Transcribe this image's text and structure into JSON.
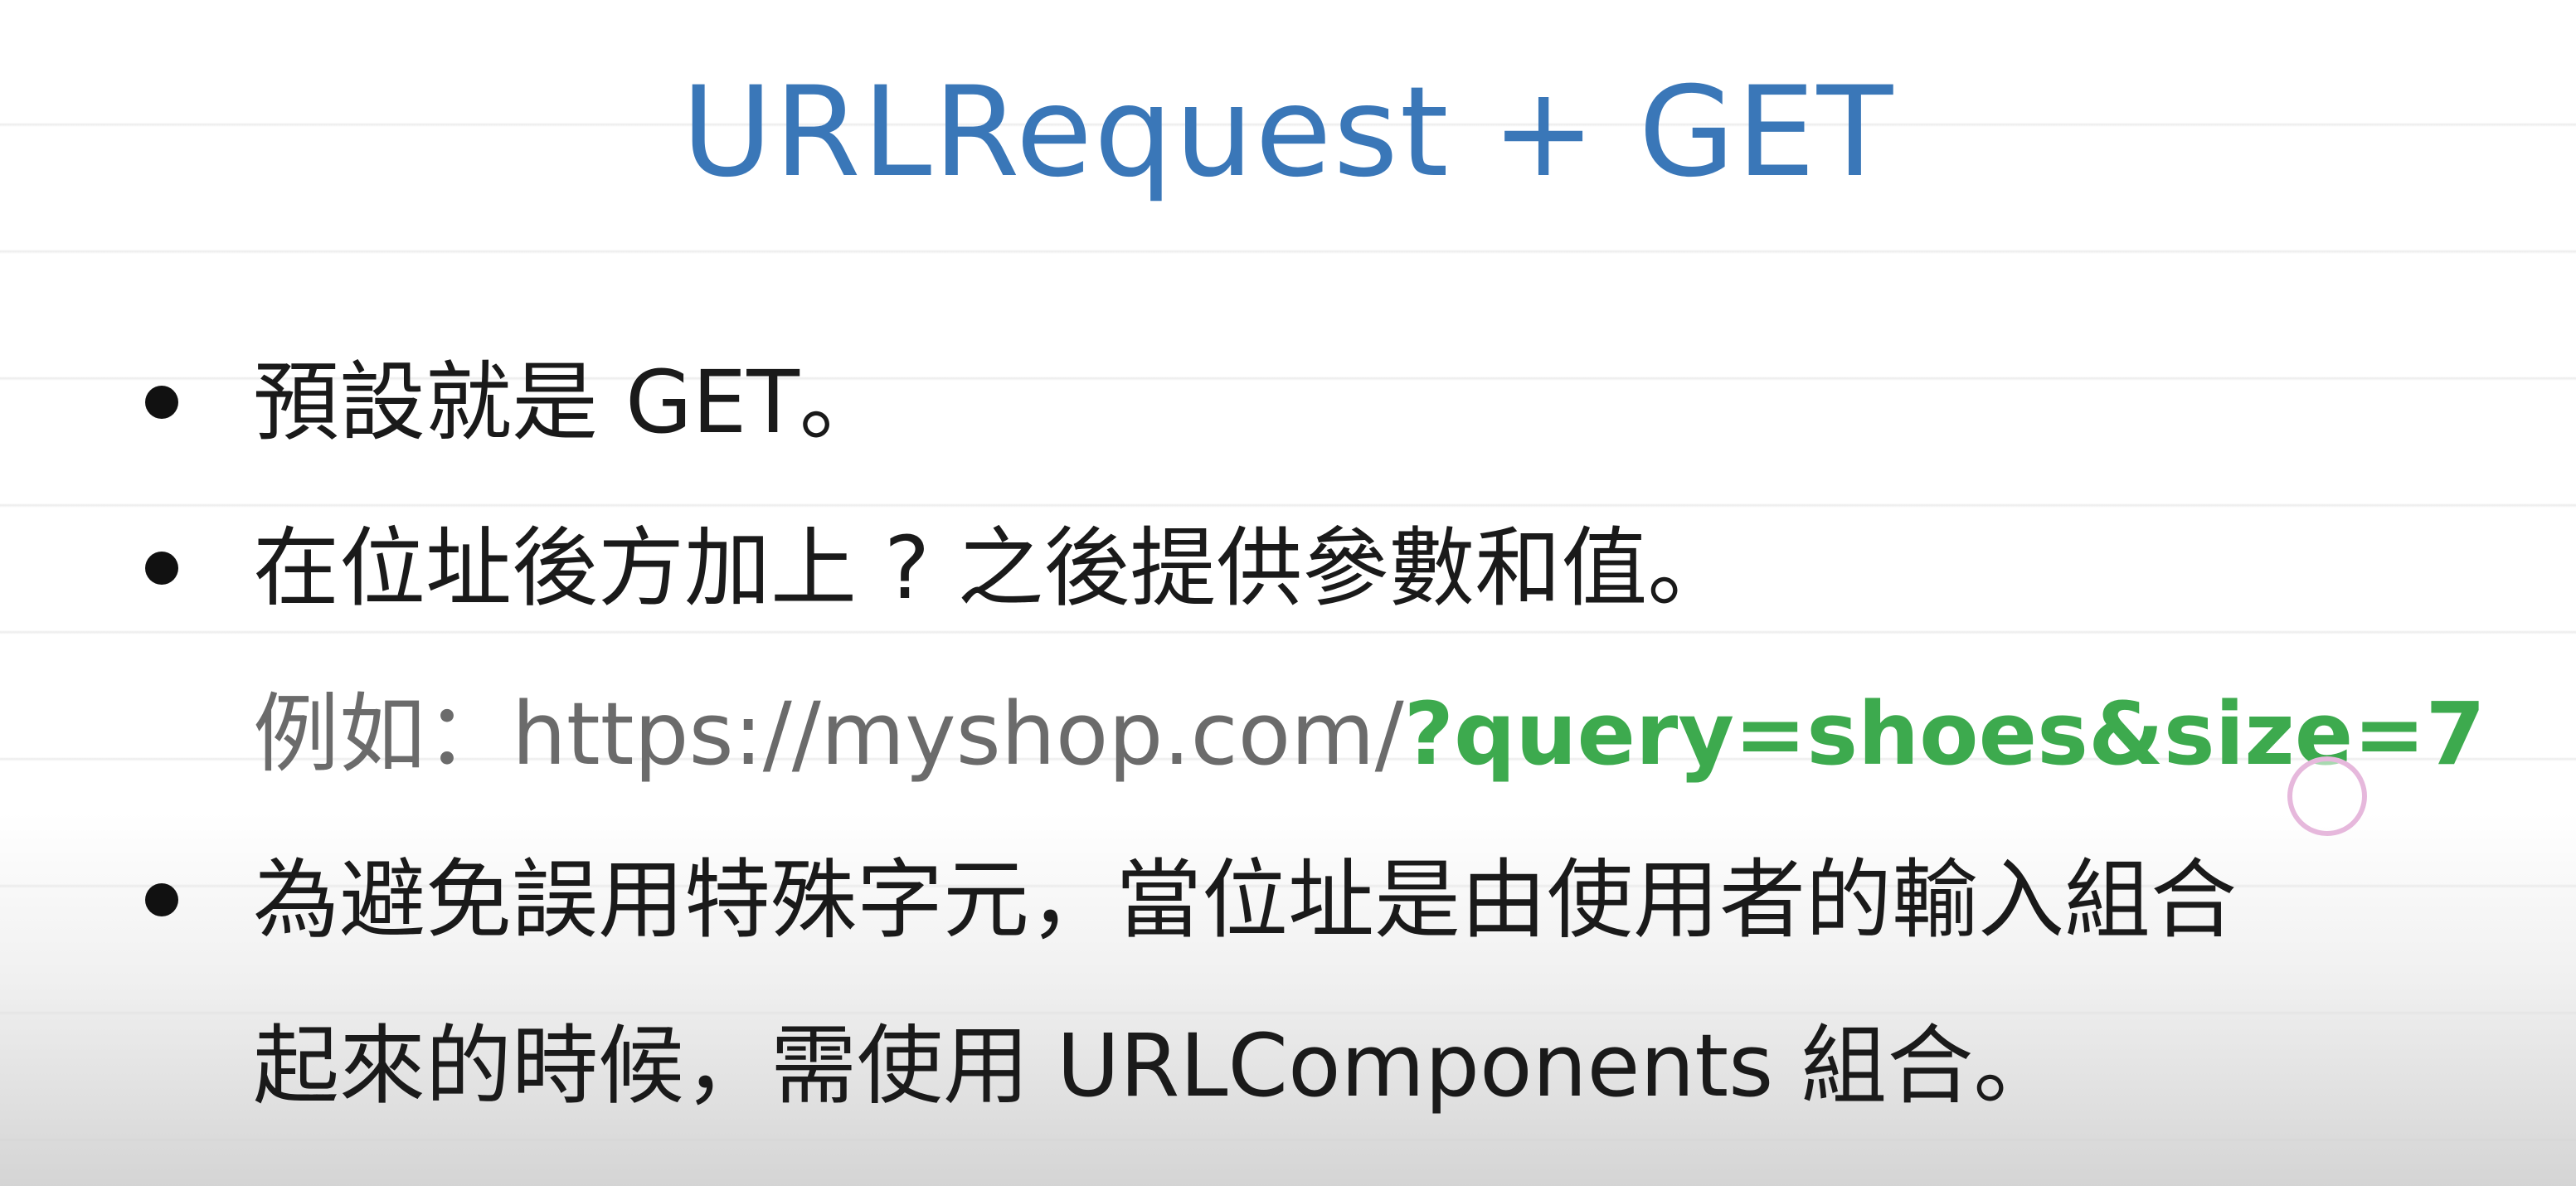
{
  "slide": {
    "title": "URLRequest + GET",
    "bullets": [
      {
        "text": "預設就是 GET。"
      },
      {
        "text": "在位址後方加上 ? 之後提供參數和值。"
      },
      {
        "text": "為避免誤用特殊字元，當位址是由使用者的輸入組合"
      }
    ],
    "example": {
      "prefix": "例如：",
      "url_base": "https://myshop.com/",
      "url_query": "?query=shoes&size=7"
    },
    "bullet3_continuation": "起來的時候，需使用 URLComponents 組合。"
  },
  "colors": {
    "title": "#3a77b8",
    "body_text": "#1a1a1a",
    "example_text": "#6b6b6b",
    "query_highlight": "#3daa4e"
  }
}
